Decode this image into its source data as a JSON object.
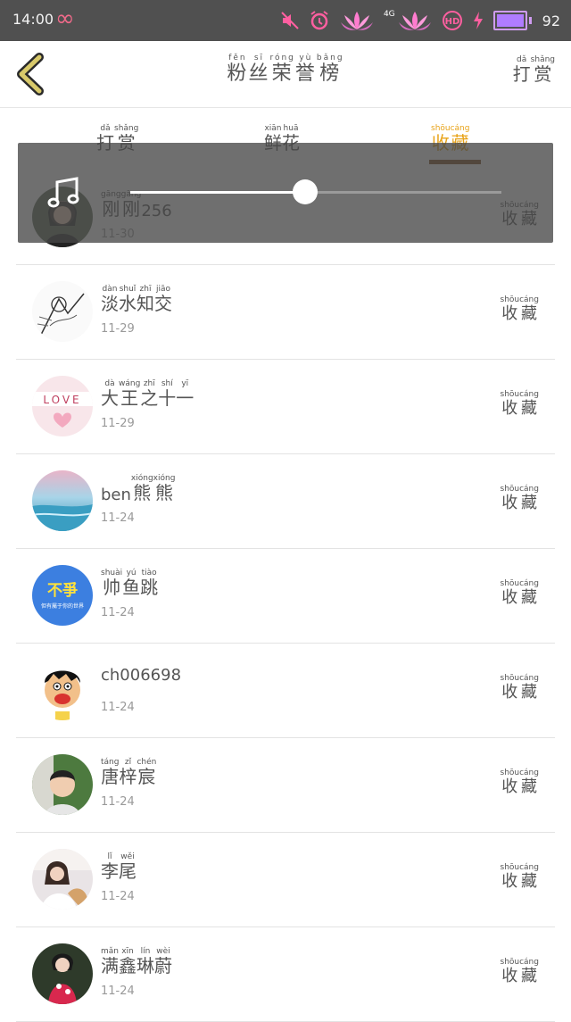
{
  "status_bar": {
    "time": "14:00",
    "network": "4G",
    "battery": "92",
    "icons": [
      "infinity-icon",
      "mute-icon",
      "alarm-icon",
      "lotus-icon",
      "lotus-icon",
      "hd-icon",
      "charging-icon",
      "battery-icon"
    ]
  },
  "header": {
    "title": [
      {
        "c": "粉",
        "p": "fěn"
      },
      {
        "c": "丝",
        "p": "sī"
      },
      {
        "c": "荣",
        "p": "róng"
      },
      {
        "c": "誉",
        "p": "yù"
      },
      {
        "c": "榜",
        "p": "bǎng"
      }
    ],
    "tip_button": [
      {
        "c": "打",
        "p": "dǎ"
      },
      {
        "c": "赏",
        "p": "shǎng"
      }
    ]
  },
  "tabs": [
    {
      "label": [
        {
          "c": "打",
          "p": "dǎ"
        },
        {
          "c": "赏",
          "p": "shǎng"
        }
      ],
      "active": false
    },
    {
      "label": [
        {
          "c": "鲜",
          "p": "xiān"
        },
        {
          "c": "花",
          "p": "huā"
        }
      ],
      "active": false
    },
    {
      "label": [
        {
          "c": "收",
          "p": "shōu"
        },
        {
          "c": "藏",
          "p": "cáng"
        }
      ],
      "active": true
    }
  ],
  "player": {
    "progress": 0.47,
    "icon": "music-note-icon"
  },
  "fav_label": [
    {
      "c": "收",
      "p": "shōu"
    },
    {
      "c": "藏",
      "p": "cáng"
    }
  ],
  "users": [
    {
      "name": [
        {
          "c": "刚",
          "p": "gāng"
        },
        {
          "c": "刚",
          "p": "gāng"
        }
      ],
      "suffix": "256",
      "date": "11-30",
      "avatar": "girl-photo"
    },
    {
      "name": [
        {
          "c": "淡",
          "p": "dàn"
        },
        {
          "c": "水",
          "p": "shuǐ"
        },
        {
          "c": "知",
          "p": "zhī"
        },
        {
          "c": "交",
          "p": "jiāo"
        }
      ],
      "suffix": "",
      "date": "11-29",
      "avatar": "sketch"
    },
    {
      "name": [
        {
          "c": "大",
          "p": "dà"
        },
        {
          "c": "王",
          "p": "wáng"
        },
        {
          "c": "之",
          "p": "zhī"
        },
        {
          "c": "十",
          "p": "shí"
        },
        {
          "c": "一",
          "p": "yī"
        }
      ],
      "suffix": "",
      "date": "11-29",
      "avatar": "love-card",
      "avatar_text": "LOVE"
    },
    {
      "name": [
        {
          "c": "熊",
          "p": "xióng"
        },
        {
          "c": "熊",
          "p": "xióng"
        }
      ],
      "prefix": "ben",
      "suffix": "",
      "date": "11-24",
      "avatar": "ocean"
    },
    {
      "name": [
        {
          "c": "帅",
          "p": "shuài"
        },
        {
          "c": "鱼",
          "p": "yú"
        },
        {
          "c": "跳",
          "p": "tiào"
        }
      ],
      "suffix": "",
      "date": "11-24",
      "avatar": "blue-badge",
      "avatar_text": "不爭",
      "avatar_subtext": "但有屬于你的世界"
    },
    {
      "name_plain": "ch006698",
      "date": "11-24",
      "avatar": "cartoon"
    },
    {
      "name": [
        {
          "c": "唐",
          "p": "táng"
        },
        {
          "c": "梓",
          "p": "zǐ"
        },
        {
          "c": "宸",
          "p": "chén"
        }
      ],
      "suffix": "",
      "date": "11-24",
      "avatar": "child-photo"
    },
    {
      "name": [
        {
          "c": "李",
          "p": "lǐ"
        },
        {
          "c": "尾",
          "p": "wěi"
        }
      ],
      "suffix": "",
      "date": "11-24",
      "avatar": "girl-white"
    },
    {
      "name": [
        {
          "c": "满",
          "p": "mǎn"
        },
        {
          "c": "鑫",
          "p": "xīn"
        },
        {
          "c": "琳",
          "p": "lín"
        },
        {
          "c": "蔚",
          "p": "wèi"
        }
      ],
      "suffix": "",
      "date": "11-24",
      "avatar": "girl-red"
    }
  ]
}
